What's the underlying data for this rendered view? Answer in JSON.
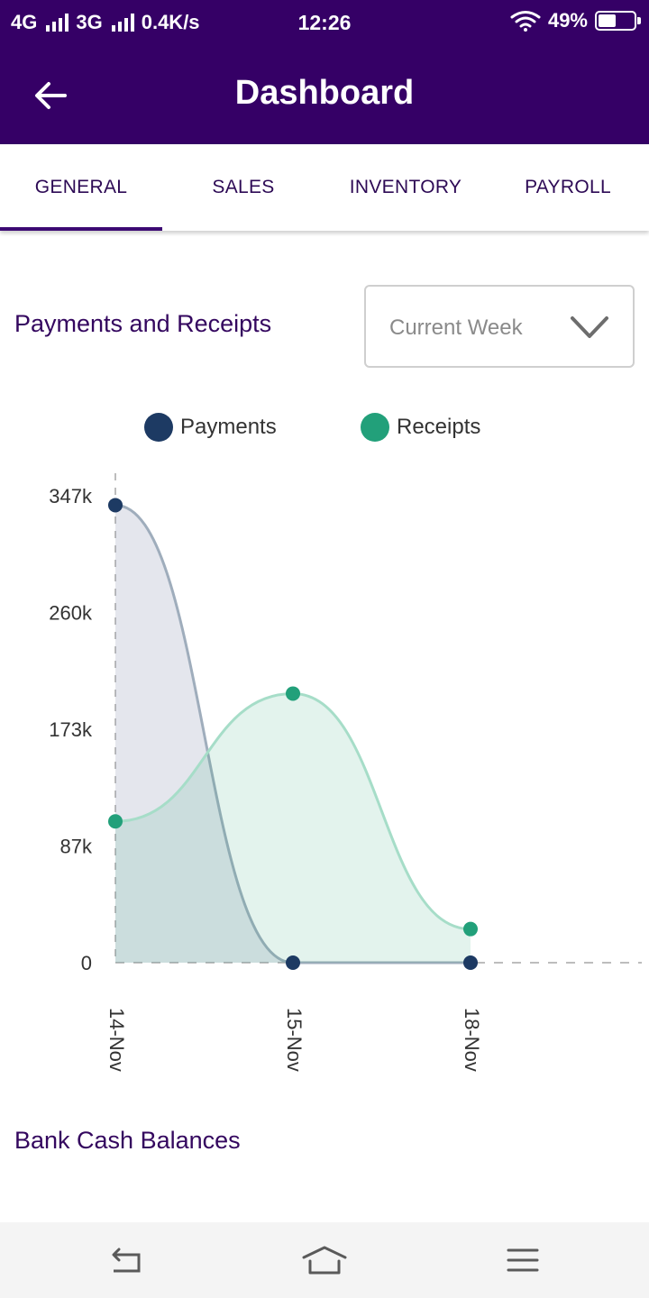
{
  "status_bar": {
    "network_1": "4G",
    "network_2": "3G",
    "speed": "0.4K/s",
    "time": "12:26",
    "battery": "49%",
    "battery_level": 0.49
  },
  "header": {
    "title": "Dashboard",
    "back_icon": "arrow-left-icon",
    "background": "#350066"
  },
  "tabs": [
    {
      "label": "GENERAL",
      "active": true
    },
    {
      "label": "SALES",
      "active": false
    },
    {
      "label": "INVENTORY",
      "active": false
    },
    {
      "label": "PAYROLL",
      "active": false
    }
  ],
  "payments_section": {
    "title": "Payments and Receipts",
    "period_select": {
      "value": "Current Week",
      "icon": "chevron-down-icon"
    }
  },
  "legend": [
    {
      "name": "Payments",
      "color": "#1d3a63"
    },
    {
      "name": "Receipts",
      "color": "#22a07a"
    }
  ],
  "chart_data": {
    "type": "area",
    "categories": [
      "14-Nov",
      "15-Nov",
      "18-Nov"
    ],
    "series": [
      {
        "name": "Payments",
        "color": "#1d3a63",
        "values": [
          340000,
          0,
          0
        ]
      },
      {
        "name": "Receipts",
        "color": "#22a07a",
        "values": [
          105000,
          200000,
          25000
        ]
      }
    ],
    "y_ticks": [
      "0",
      "87k",
      "173k",
      "260k",
      "347k"
    ],
    "ylim": [
      0,
      347000
    ],
    "grid": false,
    "legend_position": "top"
  },
  "bank_section": {
    "title": "Bank Cash Balances"
  },
  "nav_bar": {
    "back_icon": "back-nav-icon",
    "home_icon": "home-nav-icon",
    "menu_icon": "menu-nav-icon"
  }
}
